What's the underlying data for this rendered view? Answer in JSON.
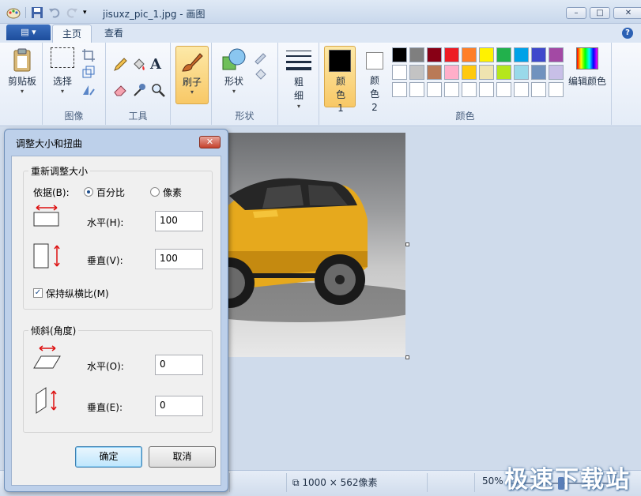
{
  "window": {
    "title": "jisuxz_pic_1.jpg - 画图",
    "controls": [
      "–",
      "□",
      "✕"
    ]
  },
  "ribbon": {
    "tabs": [
      "主页",
      "查看"
    ],
    "help": "?",
    "groups": {
      "clipboard": {
        "label": "剪贴板"
      },
      "image": {
        "label": "图像",
        "select": "选择"
      },
      "tools": {
        "label": "工具"
      },
      "brush": {
        "label": "刷子"
      },
      "shapes": {
        "label": "形状",
        "shapes_button": "形状"
      },
      "size": {
        "label": "粗细"
      },
      "colors": {
        "label": "颜色",
        "color1": "颜色 1",
        "color2": "颜色 2",
        "edit": "编辑颜色",
        "color1_value": "#000000",
        "color2_value": "#ffffff",
        "palette": [
          "#000000",
          "#7f7f7f",
          "#880015",
          "#ed1c24",
          "#ff7f27",
          "#fff200",
          "#22b14c",
          "#00a2e8",
          "#3f48cc",
          "#a349a4",
          "#ffffff",
          "#c3c3c3",
          "#b97a57",
          "#ffaec9",
          "#ffc90e",
          "#efe4b0",
          "#b5e61d",
          "#99d9ea",
          "#7092be",
          "#c8bfe7"
        ]
      }
    }
  },
  "status": {
    "image_size": "1000 × 562像素",
    "zoom": "50%"
  },
  "watermark": "极速下载站",
  "dialog": {
    "title": "调整大小和扭曲",
    "close": "✕",
    "resize": {
      "legend": "重新调整大小",
      "by_label": "依据(B):",
      "option_percent": "百分比",
      "option_pixels": "像素",
      "selected": "percent",
      "horizontal_label": "水平(H):",
      "horizontal_value": "100",
      "vertical_label": "垂直(V):",
      "vertical_value": "100",
      "keep_ratio_label": "保持纵横比(M)",
      "keep_ratio_checked": true
    },
    "skew": {
      "legend": "倾斜(角度)",
      "horizontal_label": "水平(O):",
      "horizontal_value": "0",
      "vertical_label": "垂直(E):",
      "vertical_value": "0"
    },
    "ok": "确定",
    "cancel": "取消"
  }
}
